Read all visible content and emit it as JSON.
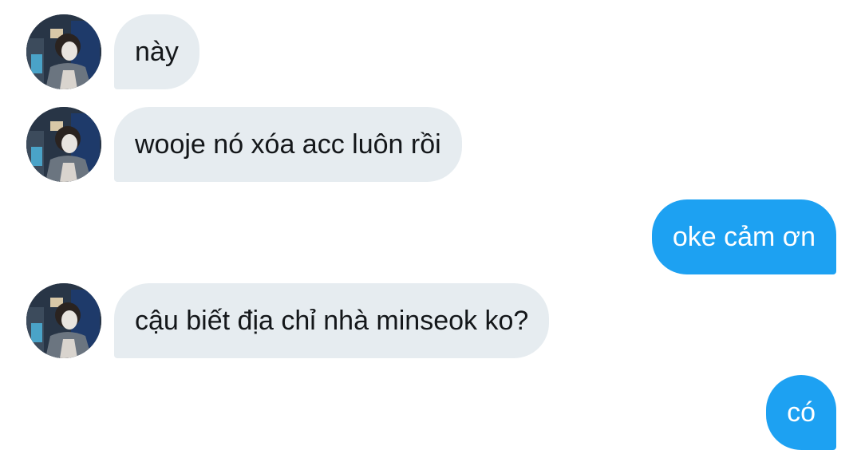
{
  "conversation": {
    "messages": [
      {
        "direction": "incoming",
        "text": "này"
      },
      {
        "direction": "incoming",
        "text": "wooje nó xóa acc luôn rồi"
      },
      {
        "direction": "outgoing",
        "text": "oke cảm ơn"
      },
      {
        "direction": "incoming",
        "text": "cậu biết địa chỉ nhà minseok ko?"
      },
      {
        "direction": "outgoing",
        "text": "có"
      }
    ]
  },
  "colors": {
    "incoming_bubble": "#e6ecf0",
    "incoming_text": "#14171a",
    "outgoing_bubble": "#1da1f2",
    "outgoing_text": "#ffffff"
  },
  "icons": {
    "avatar": "user-avatar-photo"
  }
}
